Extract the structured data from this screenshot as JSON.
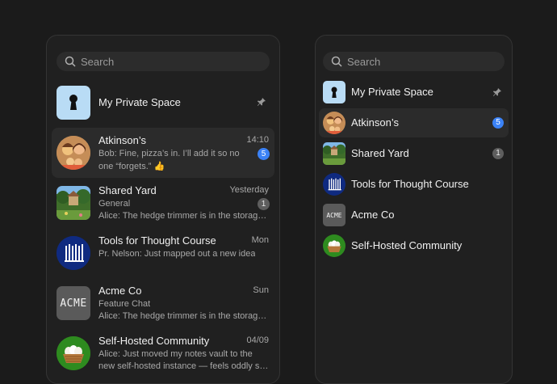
{
  "left": {
    "search_placeholder": "Search",
    "private_space": {
      "name": "My Private Space"
    },
    "chats": [
      {
        "name": "Atkinson’s",
        "time": "14:10",
        "preview_line1": "Bob: Fine, pizza’s in. I’ll add it so no",
        "preview_line2": "one “forgets.” 👍",
        "badge": "5",
        "badge_color": "#3b82f6"
      },
      {
        "name": "Shared Yard",
        "time": "Yesterday",
        "subtitle": "General",
        "preview": "Alice: The hedge trimmer is in the storage…",
        "badge": "1",
        "badge_color": "#5e5e5e"
      },
      {
        "name": "Tools for Thought Course",
        "time": "Mon",
        "preview": "Pr. Nelson: Just mapped out a new idea"
      },
      {
        "name": "Acme Co",
        "time": "Sun",
        "subtitle": "Feature Chat",
        "preview": "Alice: The hedge trimmer is in the storage…"
      },
      {
        "name": "Self-Hosted Community",
        "time": "04/09",
        "preview_line1": "Alice: Just moved my notes vault to the",
        "preview_line2": "new self-hosted instance — feels oddly s…"
      }
    ]
  },
  "right": {
    "search_placeholder": "Search",
    "items": [
      {
        "name": "My Private Space"
      },
      {
        "name": "Atkinson’s",
        "badge": "5"
      },
      {
        "name": "Shared Yard",
        "badge": "1"
      },
      {
        "name": "Tools for Thought Course"
      },
      {
        "name": "Acme Co"
      },
      {
        "name": "Self-Hosted Community"
      }
    ]
  },
  "logos": {
    "acme": "ACME"
  },
  "colors": {
    "unread_blue": "#3b82f6",
    "muted_badge": "#5e5e5e",
    "tools_navy": "#0f2a80",
    "community_green": "#2e8b1f",
    "private_space_blue": "#b9dcf5"
  }
}
